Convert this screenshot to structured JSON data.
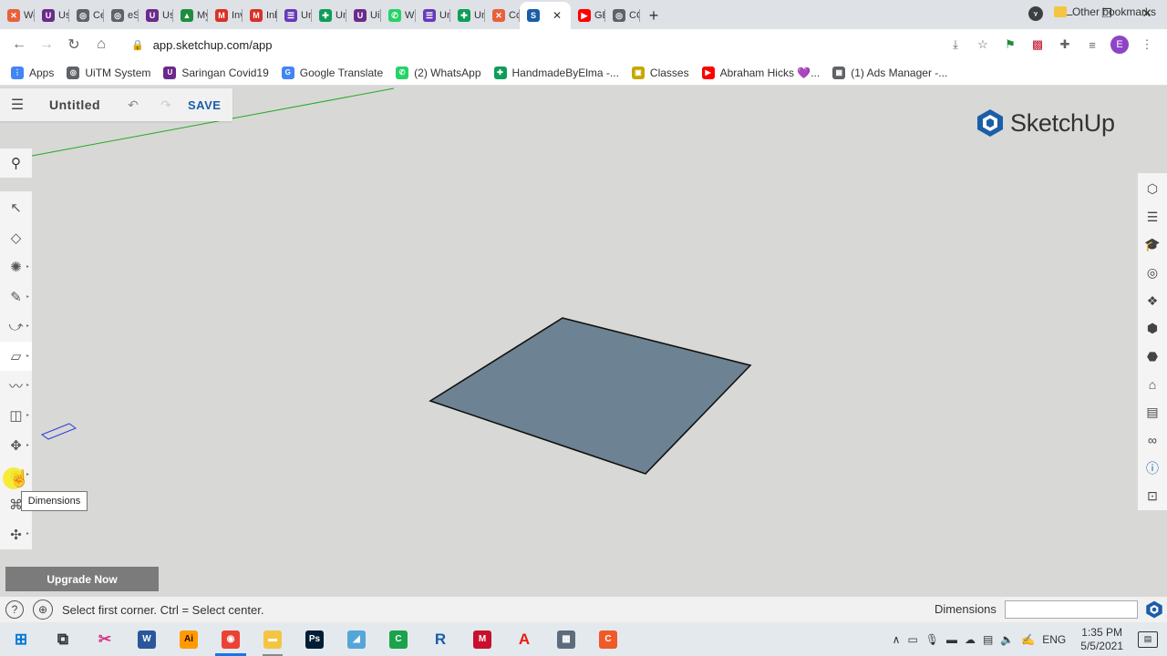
{
  "browser": {
    "tabs": [
      {
        "label": "Wel",
        "color": "#e8603c",
        "glyph": "✕"
      },
      {
        "label": "Use",
        "color": "#6a2b8a",
        "glyph": "U"
      },
      {
        "label": "Cert",
        "color": "#5f6368",
        "glyph": "◎"
      },
      {
        "label": "eSu",
        "color": "#5f6368",
        "glyph": "◎"
      },
      {
        "label": "Use",
        "color": "#6a2b8a",
        "glyph": "U"
      },
      {
        "label": "My",
        "color": "#1e8e3e",
        "glyph": "▲"
      },
      {
        "label": "Invit",
        "color": "#d93025",
        "glyph": "M"
      },
      {
        "label": "Inbc",
        "color": "#d93025",
        "glyph": "M"
      },
      {
        "label": "Unt",
        "color": "#673ab7",
        "glyph": "☰"
      },
      {
        "label": "Unt",
        "color": "#0f9d58",
        "glyph": "✚"
      },
      {
        "label": "UiTI",
        "color": "#6a2b8a",
        "glyph": "U"
      },
      {
        "label": "Wh",
        "color": "#25d366",
        "glyph": "✆"
      },
      {
        "label": "Unt",
        "color": "#673ab7",
        "glyph": "☰"
      },
      {
        "label": "Unt",
        "color": "#0f9d58",
        "glyph": "✚"
      },
      {
        "label": "Cor",
        "color": "#e8603c",
        "glyph": "✕"
      },
      {
        "label": "",
        "color": "#1a5ea8",
        "glyph": "S",
        "active": true
      },
      {
        "label": "GET",
        "color": "#ff0000",
        "glyph": "▶"
      },
      {
        "label": "COS",
        "color": "#5f6368",
        "glyph": "◎"
      }
    ],
    "url": "app.sketchup.com/app",
    "profile_initial": "E",
    "bookmarks": [
      {
        "label": "Apps",
        "color": "#4285f4",
        "glyph": "⋮"
      },
      {
        "label": "UiTM System",
        "color": "#5f6368",
        "glyph": "◎"
      },
      {
        "label": "Saringan Covid19",
        "color": "#6a2b8a",
        "glyph": "U"
      },
      {
        "label": "Google Translate",
        "color": "#4285f4",
        "glyph": "G"
      },
      {
        "label": "(2) WhatsApp",
        "color": "#25d366",
        "glyph": "✆"
      },
      {
        "label": "HandmadeByElma -...",
        "color": "#0f9d58",
        "glyph": "✚"
      },
      {
        "label": "Classes",
        "color": "#c6a700",
        "glyph": "▣"
      },
      {
        "label": "Abraham Hicks 💜...",
        "color": "#ff0000",
        "glyph": "▶"
      },
      {
        "label": "(1) Ads Manager -...",
        "color": "#5f6368",
        "glyph": "▦"
      }
    ],
    "bookmarks_more": "»",
    "other_bookmarks": "Other bookmarks"
  },
  "app": {
    "title": "Untitled",
    "save_label": "SAVE",
    "logo_text": "SketchUp",
    "tooltip": "Dimensions",
    "upgrade_label": "Upgrade Now",
    "left_tools": [
      {
        "name": "select-tool",
        "glyph": "↖"
      },
      {
        "name": "eraser-tool",
        "glyph": "◇"
      },
      {
        "name": "paint-tool",
        "glyph": "✺",
        "tri": true
      },
      {
        "name": "line-tool",
        "glyph": "✎",
        "tri": true
      },
      {
        "name": "arc-tool",
        "glyph": "⤻",
        "tri": true
      },
      {
        "name": "rectangle-tool",
        "glyph": "▱",
        "tri": true,
        "active": true
      },
      {
        "name": "push-pull-tool",
        "glyph": "〰",
        "tri": true
      },
      {
        "name": "offset-tool",
        "glyph": "◫",
        "tri": true
      },
      {
        "name": "move-tool",
        "glyph": "✥",
        "tri": true
      },
      {
        "name": "tape-measure-tool",
        "glyph": "◉",
        "tri": true
      },
      {
        "name": "walk-tool",
        "glyph": "⌘",
        "tri": true
      },
      {
        "name": "orbit-tool",
        "glyph": "✣",
        "tri": true
      }
    ],
    "right_tools": [
      {
        "name": "entity-info-icon",
        "glyph": "⬡"
      },
      {
        "name": "outliner-icon",
        "glyph": "☰"
      },
      {
        "name": "instructor-icon",
        "glyph": "🎓"
      },
      {
        "name": "materials-icon",
        "glyph": "◎"
      },
      {
        "name": "components-icon",
        "glyph": "❖"
      },
      {
        "name": "styles-icon",
        "glyph": "⬢"
      },
      {
        "name": "3d-warehouse-icon",
        "glyph": "⬣"
      },
      {
        "name": "tags-icon",
        "glyph": "⌂"
      },
      {
        "name": "scenes-icon",
        "glyph": "▤"
      },
      {
        "name": "display-icon",
        "glyph": "∞"
      },
      {
        "name": "info-icon",
        "glyph": "ⓘ"
      },
      {
        "name": "solar-icon",
        "glyph": "⊡"
      }
    ]
  },
  "status": {
    "help": "?",
    "message": "Select first corner. Ctrl = Select center.",
    "measure_label": "Dimensions",
    "measure_value": ""
  },
  "taskbar": {
    "apps": [
      {
        "name": "start-button",
        "glyph": "⊞",
        "color": "#0078d4",
        "text": true
      },
      {
        "name": "task-view",
        "glyph": "⧉",
        "color": "#333",
        "text": true
      },
      {
        "name": "snipping-tool",
        "glyph": "✂",
        "color": "#d63384",
        "text": true
      },
      {
        "name": "word",
        "glyph": "W",
        "color": "#2b579a"
      },
      {
        "name": "illustrator",
        "glyph": "Ai",
        "color": "#ff9a00",
        "dark": true
      },
      {
        "name": "chrome",
        "glyph": "◉",
        "color": "#ea4335",
        "active": true
      },
      {
        "name": "file-explorer",
        "glyph": "▬",
        "color": "#f4c542",
        "open": true
      },
      {
        "name": "photoshop",
        "glyph": "Ps",
        "color": "#001e36"
      },
      {
        "name": "sketchup-desktop",
        "glyph": "◢",
        "color": "#55a6d8"
      },
      {
        "name": "camtasia",
        "glyph": "C",
        "color": "#1aa34a"
      },
      {
        "name": "revit",
        "glyph": "R",
        "color": "#1a5ea8",
        "text": true
      },
      {
        "name": "miro",
        "glyph": "M",
        "color": "#c8102e"
      },
      {
        "name": "acrobat",
        "glyph": "A",
        "color": "#ea1c0d",
        "text": true
      },
      {
        "name": "calculator",
        "glyph": "▦",
        "color": "#5c6c7c"
      },
      {
        "name": "app-c",
        "glyph": "C",
        "color": "#f05a28"
      }
    ],
    "lang": "ENG",
    "time": "1:35 PM",
    "date": "5/5/2021"
  },
  "colors": {
    "accent": "#1a5ea8",
    "face": "#6d8292",
    "edge": "#111111",
    "green_axis": "#22aa22"
  }
}
